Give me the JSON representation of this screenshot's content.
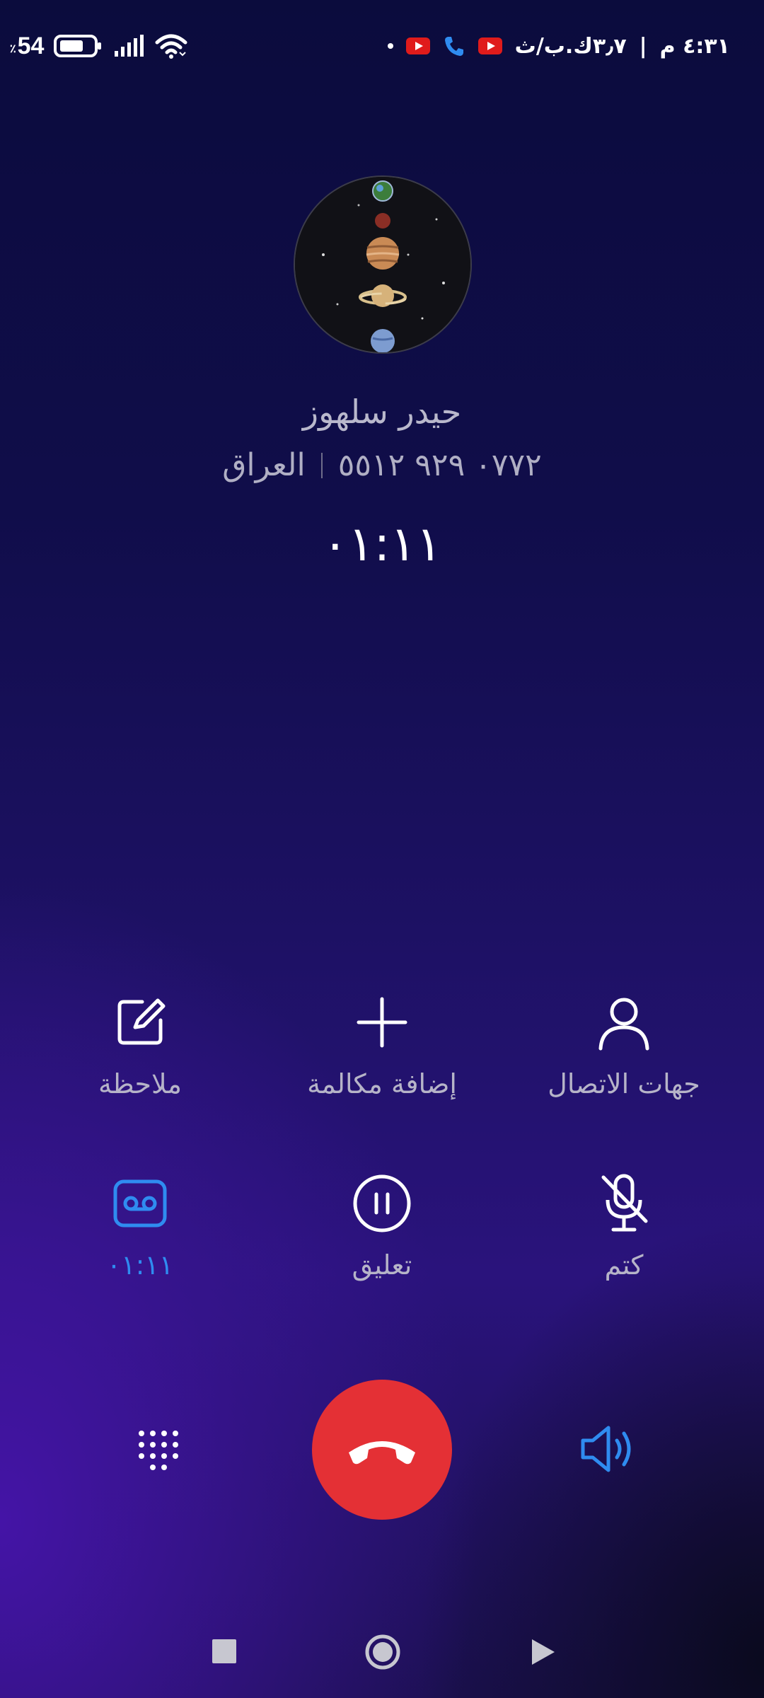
{
  "status_bar": {
    "time": "٤:٣١ م",
    "network_speed": "٣٫٧ك.ب/ث",
    "battery_level": "54",
    "battery_percent_sign": "٪",
    "icons": [
      "youtube-icon",
      "phone-icon",
      "youtube-icon",
      "notification-dot",
      "wifi-icon",
      "signal-icon",
      "battery-icon"
    ]
  },
  "contact": {
    "name": "حيدر سلهوز",
    "phone": "٠٧٧٢ ٩٢٩ ٥٥١٢",
    "country": "العراق"
  },
  "call": {
    "duration": "٠١:١١"
  },
  "actions": {
    "note_label": "ملاحظة",
    "add_call_label": "إضافة مكالمة",
    "contacts_label": "جهات الاتصال",
    "record_label": "٠١:١١",
    "hold_label": "تعليق",
    "mute_label": "كتم"
  },
  "colors": {
    "accent": "#2f8cf0",
    "end_call": "#e43035",
    "label": "#b6b4c8"
  }
}
